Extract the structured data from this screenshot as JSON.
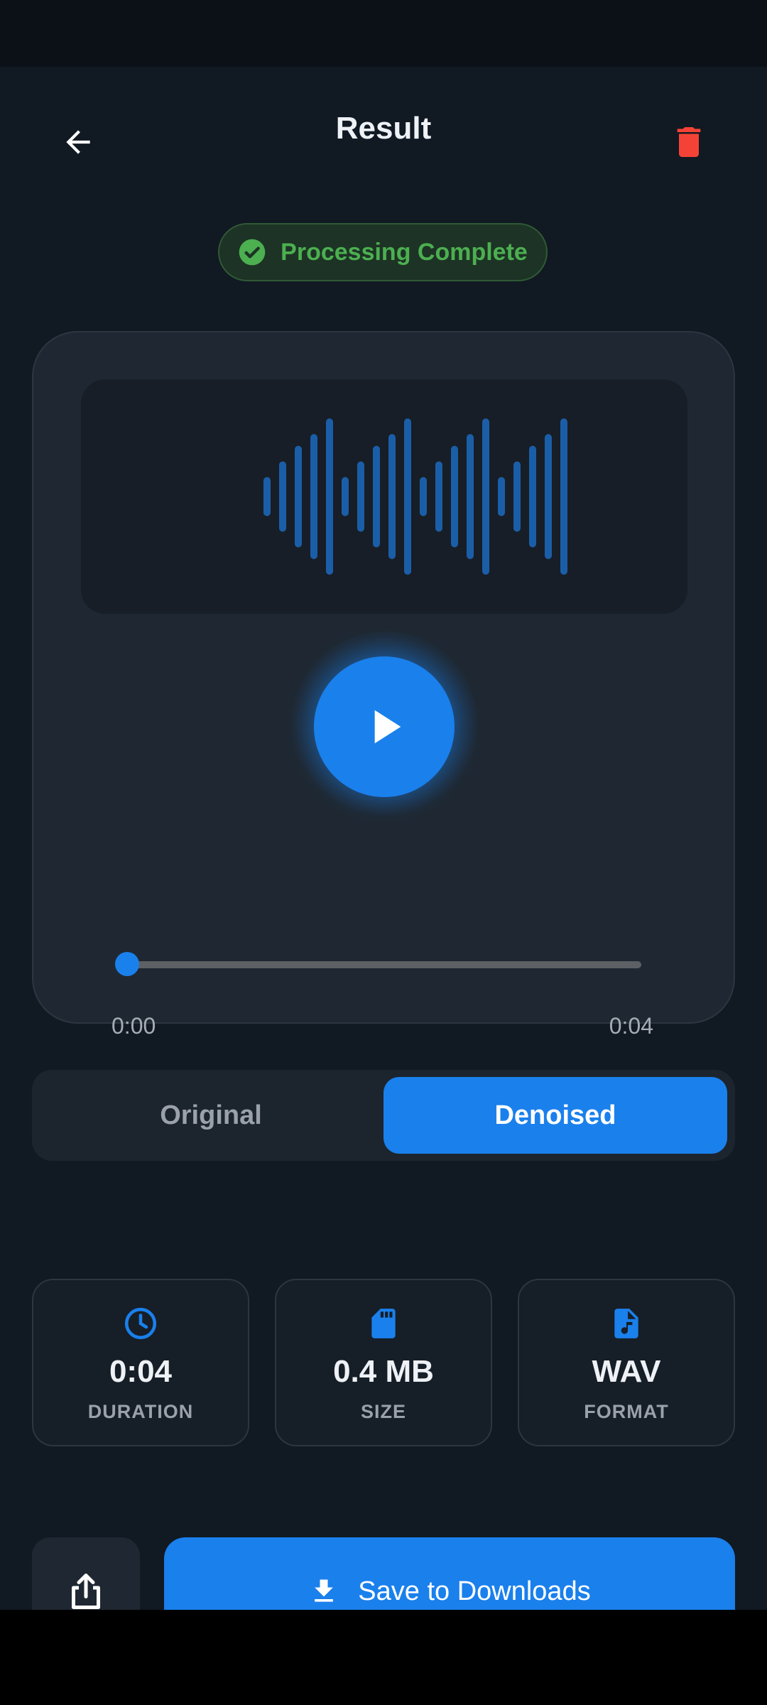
{
  "header": {
    "title": "Result",
    "back_icon": "arrow-left-icon",
    "delete_icon": "trash-icon"
  },
  "status": {
    "text": "Processing Complete",
    "icon": "check-circle-icon"
  },
  "player": {
    "time_current": "0:00",
    "time_total": "0:04",
    "progress": 0,
    "play_icon": "play-icon",
    "waveform_levels": [
      0.25,
      0.45,
      0.65,
      0.8,
      1.0,
      0.25,
      0.45,
      0.65,
      0.8,
      1.0,
      0.25,
      0.45,
      0.65,
      0.8,
      1.0,
      0.25,
      0.45,
      0.65,
      0.8,
      1.0
    ]
  },
  "toggle": {
    "options": [
      "Original",
      "Denoised"
    ],
    "selected": "Denoised"
  },
  "info": [
    {
      "value": "0:04",
      "label": "DURATION",
      "icon": "clock-icon"
    },
    {
      "value": "0.4 MB",
      "label": "SIZE",
      "icon": "sd-card-icon"
    },
    {
      "value": "WAV",
      "label": "FORMAT",
      "icon": "audio-file-icon"
    }
  ],
  "actions": {
    "share_icon": "share-icon",
    "save_label": "Save to Downloads",
    "save_icon": "download-icon"
  },
  "colors": {
    "accent": "#1a80ec",
    "success": "#4caf50",
    "danger": "#f44336",
    "background": "#111923"
  }
}
